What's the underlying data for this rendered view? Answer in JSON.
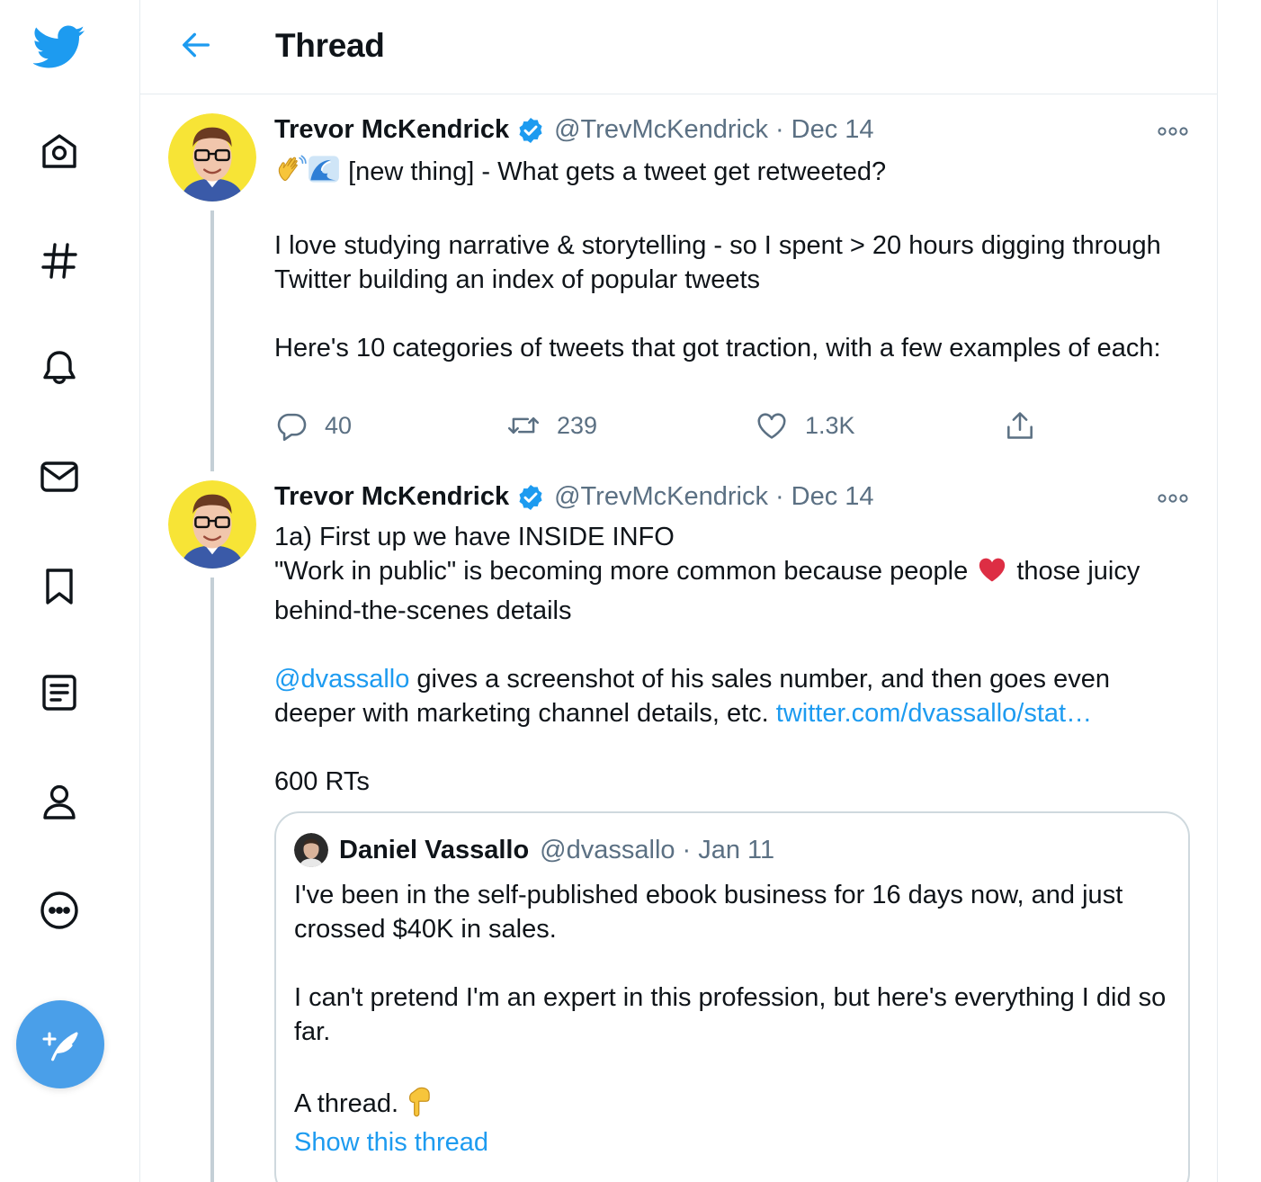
{
  "header": {
    "title": "Thread"
  },
  "sidebar": {
    "items": [
      {
        "name": "twitter-logo-icon"
      },
      {
        "name": "home-icon"
      },
      {
        "name": "explore-hashtag-icon"
      },
      {
        "name": "notifications-bell-icon"
      },
      {
        "name": "messages-envelope-icon"
      },
      {
        "name": "bookmarks-icon"
      },
      {
        "name": "lists-icon"
      },
      {
        "name": "profile-icon"
      },
      {
        "name": "more-circle-icon"
      }
    ],
    "compose_icon": "compose-tweet-icon"
  },
  "colors": {
    "accent": "#1d9bf0",
    "compose": "#4a9fe9",
    "secondary_text": "#5b7083",
    "heart": "#e0245e"
  },
  "tweets": [
    {
      "name": "Trevor McKendrick",
      "handle": "@TrevMcKendrick",
      "separator": "·",
      "date": "Dec 14",
      "line1": "[new thing] - What gets a tweet get retweeted?",
      "line2": "I love studying narrative & storytelling - so I spent > 20 hours digging through Twitter building an index of popular tweets",
      "line3": "Here's 10 categories of tweets that got traction, with a few examples of each:",
      "replies": "40",
      "retweets": "239",
      "likes": "1.3K"
    },
    {
      "name": "Trevor McKendrick",
      "handle": "@TrevMcKendrick",
      "separator": "·",
      "date": "Dec 14",
      "line1": "1a) First up we have INSIDE INFO",
      "line2a": "\"Work in public\" is becoming more common because people",
      "line2b": " those juicy behind-the-scenes details",
      "mention": "@dvassallo",
      "line3": " gives a screenshot of his sales number, and then goes even deeper with marketing channel details, etc. ",
      "link": "twitter.com/dvassallo/stat…",
      "line4": "600 RTs",
      "quote": {
        "name": "Daniel Vassallo",
        "handle": "@dvassallo",
        "separator": "·",
        "date": "Jan 11",
        "line1": "I've been in the self-published ebook business for 16 days now, and just crossed $40K in sales.",
        "line2": "I can't pretend I'm an expert in this profession, but here's everything I did so far.",
        "line3": "A thread.",
        "show_thread": "Show this thread"
      }
    }
  ]
}
